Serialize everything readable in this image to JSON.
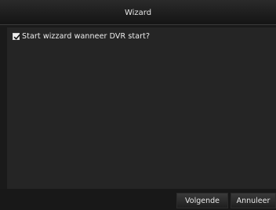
{
  "window": {
    "title": "Wizard"
  },
  "options": {
    "start_wizard": {
      "label": "Start wizzard wanneer DVR start?",
      "checked": true
    }
  },
  "buttons": {
    "next_label": "Volgende",
    "cancel_label": "Annuleer"
  },
  "colors": {
    "background": "#1a1a1a",
    "panel": "#252525",
    "text": "#eeeeee"
  }
}
